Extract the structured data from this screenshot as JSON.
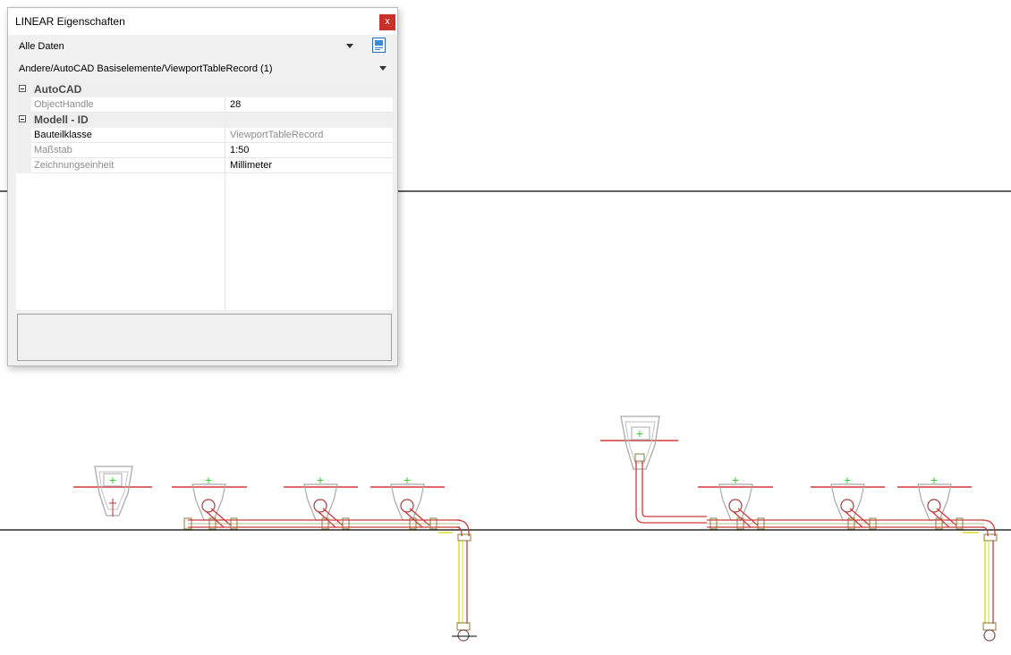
{
  "palette": {
    "title": "LINEAR Eigenschaften",
    "close_label": "x",
    "filter_combo": {
      "value": "Alle Daten"
    },
    "object_combo": {
      "value": "Andere/AutoCAD Basiselemente/ViewportTableRecord (1)"
    },
    "categories": [
      {
        "label": "AutoCAD",
        "properties": [
          {
            "name": "ObjectHandle",
            "value": "28",
            "name_greyed": true,
            "value_greyed": false
          }
        ]
      },
      {
        "label": "Modell - ID",
        "properties": [
          {
            "name": "Bauteilklasse",
            "value": "ViewportTableRecord",
            "name_greyed": false,
            "value_greyed": true
          },
          {
            "name": "Maßstab",
            "value": "1:50",
            "name_greyed": true,
            "value_greyed": false
          },
          {
            "name": "Zeichnungseinheit",
            "value": "Millimeter",
            "name_greyed": true,
            "value_greyed": false
          }
        ]
      }
    ],
    "description": ""
  },
  "drawing": {
    "colors": {
      "pipe": "#d03a3a",
      "pipe_yellow": "#d6d000",
      "fixture_grey": "#a9a9a9",
      "marker_green": "#22cc22",
      "reference_line": "#000000"
    }
  }
}
